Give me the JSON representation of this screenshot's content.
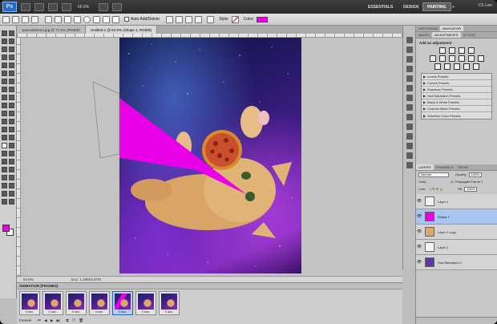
{
  "app": {
    "logo": "Ps",
    "zoom": "66.6%",
    "workspaces": [
      "ESSENTIALS",
      "DESIGN",
      "PAINTING"
    ],
    "active_workspace": "PAINTING",
    "cs_live": "CS Live"
  },
  "options": {
    "auto_add_delete": "Auto Add/Delete",
    "style_label": "Style:",
    "color_label": "Color:",
    "color_value": "#e800e8"
  },
  "tabs": [
    {
      "label": "spaceabstract.jpg @ 71.5% (RGB/8)",
      "active": false
    },
    {
      "label": "Untitled-1 @ 84.6% (Shape 1, RGB/8)",
      "active": true
    }
  ],
  "status": {
    "zoom": "84.6%",
    "doc": "Doc: 1.29M/4.87M"
  },
  "animation": {
    "title": "ANIMATION (FRAMES)",
    "frames": [
      {
        "num": "1",
        "duration": "0 sec."
      },
      {
        "num": "2",
        "duration": "0 sec."
      },
      {
        "num": "3",
        "duration": "0 sec."
      },
      {
        "num": "4",
        "duration": "0 sec."
      },
      {
        "num": "5",
        "duration": "0 sec."
      },
      {
        "num": "6",
        "duration": "0 sec."
      },
      {
        "num": "7",
        "duration": "0 sec."
      }
    ],
    "selected_frame": 5,
    "loop": "Forever"
  },
  "panels": {
    "top_tabs": [
      "HISTOGRAM",
      "NAVIGATOR"
    ],
    "second_tabs": [
      "MASKS",
      "ADJUSTMENTS",
      "STYLES"
    ],
    "adjust_title": "Add an adjustment",
    "presets": [
      "Levels Presets",
      "Curves Presets",
      "Exposure Presets",
      "Hue/Saturation Presets",
      "Black & White Presets",
      "Channel Mixer Presets",
      "Selective Color Presets"
    ],
    "layer_tabs": [
      "LAYERS",
      "CHANNELS",
      "PATHS"
    ],
    "blend_mode": "Normal",
    "opacity_label": "Opacity:",
    "opacity_value": "100%",
    "unify_label": "Unify:",
    "propagate_label": "Propagate Frame 1",
    "lock_label": "Lock:",
    "fill_label": "Fill:",
    "fill_value": "100%",
    "layers": [
      {
        "name": "Layer 1",
        "selected": false,
        "thumb": "#f0f0f0"
      },
      {
        "name": "Shape 1",
        "selected": true,
        "thumb": "#e800e8"
      },
      {
        "name": "Layer 1 copy",
        "selected": false,
        "thumb": "#d9a86c"
      },
      {
        "name": "Layer 2",
        "selected": false,
        "thumb": "#f5f5f5"
      },
      {
        "name": "Hue/Saturation 1",
        "selected": false,
        "thumb": "#5a3a9a"
      }
    ]
  }
}
